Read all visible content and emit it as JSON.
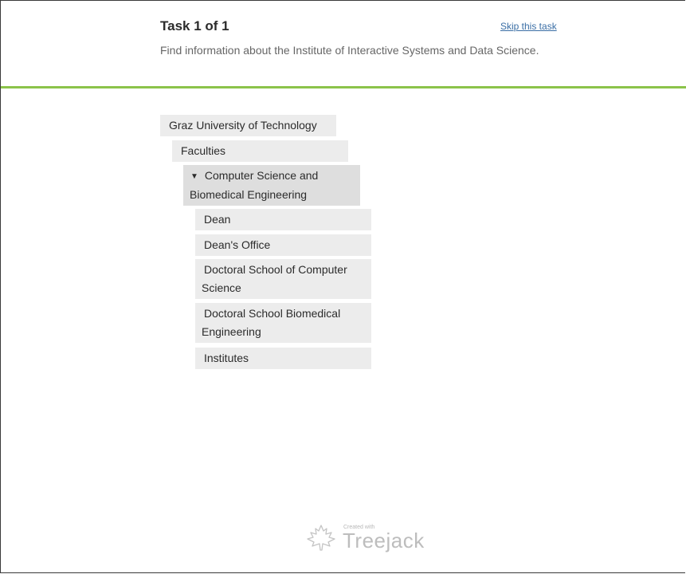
{
  "task": {
    "title": "Task 1 of 1",
    "skip_label": "Skip this task",
    "instructions": "Find information about the Institute of Interactive Systems and Data Science."
  },
  "tree": {
    "root": "Graz University of Technology",
    "level1": "Faculties",
    "expanded_node": "Computer Science and Biomedical Engineering",
    "children": [
      "Dean",
      "Dean's Office",
      "Doctoral School of Computer Science",
      "Doctoral School Biomedical Engineering",
      "Institutes"
    ]
  },
  "footer": {
    "created_with": "Created with",
    "brand": "Treejack",
    "logo_icon": "maple-leaf-icon"
  },
  "colors": {
    "accent_line": "#8bc34a",
    "link": "#3a6ea5",
    "node_bg": "#ececec"
  }
}
